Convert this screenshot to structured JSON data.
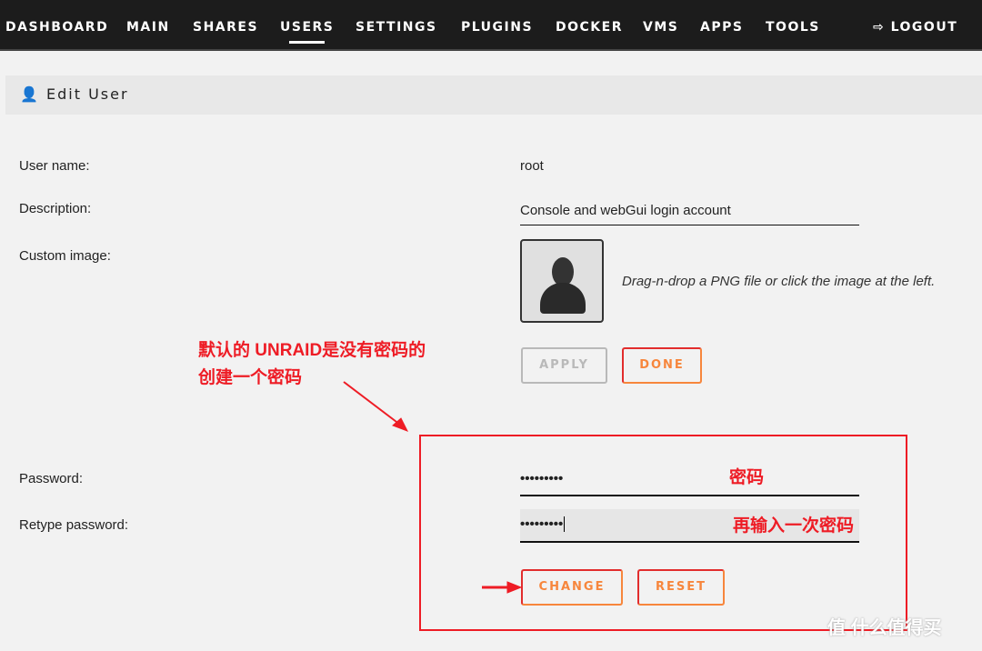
{
  "nav": {
    "items": [
      "DASHBOARD",
      "MAIN",
      "SHARES",
      "USERS",
      "SETTINGS",
      "PLUGINS",
      "DOCKER",
      "VMS",
      "APPS",
      "TOOLS"
    ],
    "active": "USERS",
    "logout": "LOGOUT"
  },
  "page": {
    "title": "Edit User"
  },
  "form": {
    "username_label": "User name:",
    "username": "root",
    "description_label": "Description:",
    "description": "Console and webGui login account",
    "image_label": "Custom image:",
    "image_hint": "Drag-n-drop a PNG file or click the image at the left.",
    "apply": "APPLY",
    "done": "DONE",
    "password_label": "Password:",
    "password": "•••••••••",
    "retype_label": "Retype password:",
    "retype": "•••••••••",
    "change": "CHANGE",
    "reset": "RESET"
  },
  "annotations": {
    "line1": "默认的 UNRAID是没有密码的",
    "line2": "创建一个密码",
    "password": "密码",
    "retype": "再输入一次密码"
  },
  "watermark": "什么值得买",
  "colors": {
    "accent": "#f7863c",
    "annotation": "#ee1c25"
  }
}
